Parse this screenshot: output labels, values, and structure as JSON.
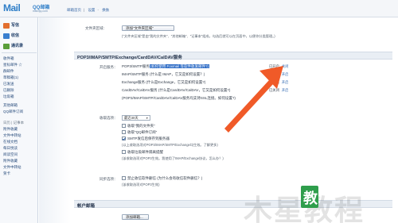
{
  "header": {
    "logo_mark": "Mail",
    "logo_qq": "QQ邮箱",
    "logo_url": "mail.qq.com",
    "links": [
      "邮箱首页",
      "设置",
      "换肤"
    ]
  },
  "sidebar": {
    "actions": [
      {
        "label": "写信",
        "icon": "pen-icon",
        "color": "#e26f2f"
      },
      {
        "label": "收信",
        "icon": "inbox-icon",
        "color": "#3a7fcf"
      },
      {
        "label": "通讯录",
        "icon": "contacts-icon",
        "color": "#5a9e3a"
      }
    ],
    "items": [
      "收件箱",
      "星标邮件 ☆",
      "群邮件",
      "草稿箱(1)",
      "已发送",
      "已删除",
      "垃圾箱",
      "其他邮箱",
      "QQ邮件订阅",
      "日历 | 记事本",
      "附件收藏",
      "文件中转站",
      "在线文档",
      "每日悦读",
      "阅读空间",
      "附件收藏",
      "文件中转站",
      "贺卡"
    ]
  },
  "main": {
    "folder_label": "文件夹区域：",
    "add_folder_button": "添加\"文件夹区域\"",
    "folder_note": "(\"文件夹区域\"是由\"我的文件夹\"、\"其他邮箱\"、\"记事本\"组成，勾选后就可以在页面中，以便你分类管理。)",
    "section_title": "POP3/IMAP/SMTP/Exchange/CardDAV/CalDAV服务",
    "service_label": "开启服务：",
    "services": [
      {
        "text": "POP3/SMTP服务",
        "highlight": "(如何使用 Foxmail 等软件收发邮件?)",
        "status": "已开启",
        "toggle": "关闭"
      },
      {
        "text": "IMAP/SMTP服务 (什么是 IMAP，它又是如何设置？)",
        "highlight": "",
        "status": "已关闭",
        "toggle": "开启"
      },
      {
        "text": "Exchange服务 (什么是Exchange，它又是如何设置?)",
        "highlight": "",
        "status": "已关闭",
        "toggle": "开启"
      },
      {
        "text": "CardDAV/CalDAV服务 (什么是CardDAV/CalDAV，它又是如何设置?)",
        "highlight": "",
        "status": "已关闭",
        "toggle": "开启"
      },
      {
        "text": "(POP3/IMAP/SMTP/CardDAV/CalDAV服务均支持SSL连接。如何设置?)",
        "highlight": "",
        "status": "",
        "toggle": ""
      }
    ],
    "receive_label": "收取选项：",
    "receive_select": "最近30天",
    "receive_options": [
      {
        "label": "收取\"我的文件夹\"",
        "checked": false
      },
      {
        "label": "收取\"QQ邮件订阅\"",
        "checked": false
      },
      {
        "label": "SMTP发信后保存到服务器",
        "checked": true
      }
    ],
    "receive_note1": "(以上收取选项对POP3/IMAP/SMTP/Exchange均生效。了解更多)",
    "receive_extra": "收取垃圾邮件隔离提醒",
    "receive_note2": "(该收取选项对POP3生效。我使用了IMAP/Exchange协议，怎么办？)",
    "sync_label": "同步选项：",
    "sync_option": "禁止收信软件删信 (为什么会有收信软件删信？)",
    "sync_note": "(该收取选项对POP3生效)",
    "account_title": "帐户邮箱",
    "account_button": "添加邮箱..."
  },
  "watermark": {
    "text": "木星教程",
    "badge": "教"
  },
  "colors": {
    "arrow": "#f05a28",
    "accent": "#2f6dc6"
  }
}
